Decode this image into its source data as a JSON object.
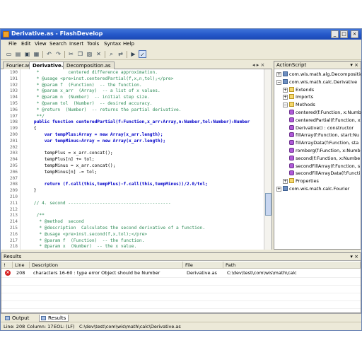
{
  "window": {
    "title": "Derivative.as - FlashDevelop",
    "controls": [
      "_",
      "□",
      "×"
    ]
  },
  "menu": [
    "File",
    "Edit",
    "View",
    "Search",
    "Insert",
    "Tools",
    "Syntax",
    "Help"
  ],
  "toolbar_icons": [
    "new-file-icon",
    "open-icon",
    "save-icon",
    "save-all-icon",
    "undo-icon",
    "redo-icon",
    "cut-icon",
    "copy-icon",
    "paste-icon",
    "delete-icon",
    "find-icon",
    "replace-icon",
    "build-icon",
    "checkbox-icon"
  ],
  "tabs": [
    {
      "label": "Fourier.as",
      "active": false
    },
    {
      "label": "Derivative.as",
      "active": true
    },
    {
      "label": "Decomposition.as",
      "active": false
    }
  ],
  "tab_controls": "◂ ▸ ×",
  "code": [
    {
      "n": "190",
      "t": "     *           centered difference approximation.",
      "c": "cm"
    },
    {
      "n": "191",
      "t": "     * @usage <pre>inst.centeredPartial(f,x,n,tol);</pre>",
      "c": "cm"
    },
    {
      "n": "192",
      "t": "     * @param f  (Function)  -- the function.",
      "c": "cm"
    },
    {
      "n": "193",
      "t": "     * @param x_arr  (Array)  -- a list of x values.",
      "c": "cm"
    },
    {
      "n": "194",
      "t": "     * @param n  (Number)  -- initial step size.",
      "c": "cm"
    },
    {
      "n": "195",
      "t": "     * @param tol  (Number)  -- desired accuracy.",
      "c": "cm"
    },
    {
      "n": "196",
      "t": "     * @return  (Number)  -- returns the partial derivative.",
      "c": "cm"
    },
    {
      "n": "197",
      "t": "     **/",
      "c": "cm"
    },
    {
      "n": "198",
      "t": "    public function centeredPartial(f:Function,x_arr:Array,n:Number,tol:Number):Number",
      "c": "kw"
    },
    {
      "n": "199",
      "t": "    {",
      "c": "pl"
    },
    {
      "n": "200",
      "t": "        var tempPlus:Array = new Array(x_arr.length);",
      "c": "kw"
    },
    {
      "n": "201",
      "t": "        var tempMinus:Array = new Array(x_arr.length);",
      "c": "kw"
    },
    {
      "n": "202",
      "t": "",
      "c": "pl"
    },
    {
      "n": "203",
      "t": "        tempPlus = x_arr.concat();",
      "c": "pl"
    },
    {
      "n": "204",
      "t": "        tempPlus[n] += tol;",
      "c": "pl"
    },
    {
      "n": "205",
      "t": "        tempMinus = x_arr.concat();",
      "c": "pl"
    },
    {
      "n": "206",
      "t": "        tempMinus[n] -= tol;",
      "c": "pl"
    },
    {
      "n": "207",
      "t": "",
      "c": "pl"
    },
    {
      "n": "208",
      "t": "        return (f.call(this,tempPlus)-f.call(this,tempMinus))/2.0/tol;",
      "c": "kw"
    },
    {
      "n": "209",
      "t": "    }",
      "c": "pl"
    },
    {
      "n": "210",
      "t": "",
      "c": "pl"
    },
    {
      "n": "211",
      "t": "    // 4. second ---------------------------------------",
      "c": "cm"
    },
    {
      "n": "212",
      "t": "",
      "c": "pl"
    },
    {
      "n": "213",
      "t": "     /**",
      "c": "cm"
    },
    {
      "n": "214",
      "t": "      * @method  second",
      "c": "cm"
    },
    {
      "n": "215",
      "t": "      * @description  Calculates the second derivative of a function.",
      "c": "cm"
    },
    {
      "n": "216",
      "t": "      * @usage <pre>inst.second(f,x,tol);</pre>",
      "c": "cm"
    },
    {
      "n": "217",
      "t": "      * @param f  (Function)  -- the function.",
      "c": "cm"
    },
    {
      "n": "218",
      "t": "      * @param x  (Number)  -- the x value.",
      "c": "cm"
    }
  ],
  "actionscript": {
    "title": "ActionScript",
    "controls": "▾ ×",
    "tree": [
      {
        "label": "com.wis.math.alg.Decomposition",
        "level": 0,
        "icon": "pkg",
        "exp": "+"
      },
      {
        "label": "com.wis.math.calc.Derivative",
        "level": 0,
        "icon": "pkg",
        "exp": "−"
      },
      {
        "label": "Extends",
        "level": 1,
        "icon": "folder",
        "exp": "+"
      },
      {
        "label": "Imports",
        "level": 1,
        "icon": "folder",
        "exp": "+"
      },
      {
        "label": "Methods",
        "level": 1,
        "icon": "folder",
        "exp": "−"
      },
      {
        "label": "centered(f:Function, x:Numb",
        "level": 2,
        "icon": "method",
        "exp": ""
      },
      {
        "label": "centeredPartial(f:Function, x",
        "level": 2,
        "icon": "method",
        "exp": ""
      },
      {
        "label": "Derivative() : constructor",
        "level": 2,
        "icon": "method",
        "exp": ""
      },
      {
        "label": "fillArray(f:Function, start:Nu",
        "level": 2,
        "icon": "method",
        "exp": ""
      },
      {
        "label": "fillArrayData(f:Function, sta",
        "level": 2,
        "icon": "method",
        "exp": ""
      },
      {
        "label": "romberg(f:Function, x:Numb",
        "level": 2,
        "icon": "method",
        "exp": ""
      },
      {
        "label": "second(f:Function, x:Numbe",
        "level": 2,
        "icon": "method",
        "exp": ""
      },
      {
        "label": "secondFillArray(f:Function, s",
        "level": 2,
        "icon": "method",
        "exp": ""
      },
      {
        "label": "secondFillArrayData(f:Functi",
        "level": 2,
        "icon": "method",
        "exp": ""
      },
      {
        "label": "Properties",
        "level": 1,
        "icon": "folder",
        "exp": "+"
      },
      {
        "label": "com.wis.math.calc.Fourier",
        "level": 0,
        "icon": "pkg",
        "exp": "+"
      }
    ]
  },
  "results": {
    "title": "Results",
    "controls": "▾ ×",
    "columns": [
      "!",
      "Line",
      "Description",
      "File",
      "Path"
    ],
    "rows": [
      {
        "line": "208",
        "description": "characters 16-60 : type error Object should be Number",
        "file": "Derivative.as",
        "path": "C:\\dev\\test\\com\\wis\\math\\calc"
      }
    ]
  },
  "bottom_tabs": [
    {
      "label": "Output",
      "active": false
    },
    {
      "label": "Results",
      "active": true
    }
  ],
  "status": {
    "line": "Line: 208",
    "column": "Column: 17",
    "eol": "EOL: (LF)",
    "path": "C:\\dev\\test\\com\\wis\\math\\calc\\Derivative.as"
  }
}
